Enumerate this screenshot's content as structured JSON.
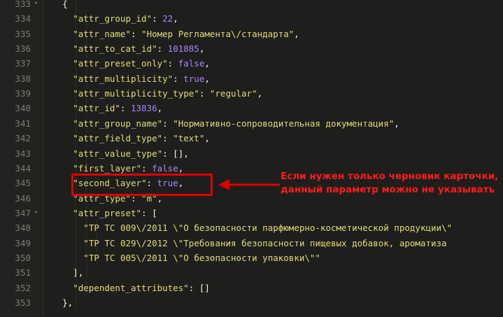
{
  "editor": {
    "lines": [
      {
        "num": "333",
        "fold": "▾",
        "indent": 7,
        "parts": [
          {
            "t": "{",
            "c": "p"
          }
        ]
      },
      {
        "num": "334",
        "fold": "",
        "indent": 9,
        "parts": [
          {
            "t": "\"attr_group_id\"",
            "c": "k"
          },
          {
            "t": ": ",
            "c": "p"
          },
          {
            "t": "22",
            "c": "n"
          },
          {
            "t": ",",
            "c": "p"
          }
        ]
      },
      {
        "num": "335",
        "fold": "",
        "indent": 9,
        "parts": [
          {
            "t": "\"attr_name\"",
            "c": "k"
          },
          {
            "t": ": ",
            "c": "p"
          },
          {
            "t": "\"Номер Регламента\\/стандарта\"",
            "c": "s"
          },
          {
            "t": ",",
            "c": "p"
          }
        ]
      },
      {
        "num": "336",
        "fold": "",
        "indent": 9,
        "parts": [
          {
            "t": "\"attr_to_cat_id\"",
            "c": "k"
          },
          {
            "t": ": ",
            "c": "p"
          },
          {
            "t": "101885",
            "c": "n"
          },
          {
            "t": ",",
            "c": "p"
          }
        ]
      },
      {
        "num": "337",
        "fold": "",
        "indent": 9,
        "parts": [
          {
            "t": "\"attr_preset_only\"",
            "c": "k"
          },
          {
            "t": ": ",
            "c": "p"
          },
          {
            "t": "false",
            "c": "b"
          },
          {
            "t": ",",
            "c": "p"
          }
        ]
      },
      {
        "num": "338",
        "fold": "",
        "indent": 9,
        "parts": [
          {
            "t": "\"attr_multiplicity\"",
            "c": "k"
          },
          {
            "t": ": ",
            "c": "p"
          },
          {
            "t": "true",
            "c": "b"
          },
          {
            "t": ",",
            "c": "p"
          }
        ]
      },
      {
        "num": "339",
        "fold": "",
        "indent": 9,
        "parts": [
          {
            "t": "\"attr_multiplicity_type\"",
            "c": "k"
          },
          {
            "t": ": ",
            "c": "p"
          },
          {
            "t": "\"regular\"",
            "c": "s"
          },
          {
            "t": ",",
            "c": "p"
          }
        ]
      },
      {
        "num": "340",
        "fold": "",
        "indent": 9,
        "parts": [
          {
            "t": "\"attr_id\"",
            "c": "k"
          },
          {
            "t": ": ",
            "c": "p"
          },
          {
            "t": "13836",
            "c": "n"
          },
          {
            "t": ",",
            "c": "p"
          }
        ]
      },
      {
        "num": "341",
        "fold": "",
        "indent": 9,
        "parts": [
          {
            "t": "\"attr_group_name\"",
            "c": "k"
          },
          {
            "t": ": ",
            "c": "p"
          },
          {
            "t": "\"Нормативно-сопроводительная документация\"",
            "c": "s"
          },
          {
            "t": ",",
            "c": "p"
          }
        ]
      },
      {
        "num": "342",
        "fold": "",
        "indent": 9,
        "parts": [
          {
            "t": "\"attr_field_type\"",
            "c": "k"
          },
          {
            "t": ": ",
            "c": "p"
          },
          {
            "t": "\"text\"",
            "c": "s"
          },
          {
            "t": ",",
            "c": "p"
          }
        ]
      },
      {
        "num": "343",
        "fold": "",
        "indent": 9,
        "parts": [
          {
            "t": "\"attr_value_type\"",
            "c": "k"
          },
          {
            "t": ": [],",
            "c": "p"
          }
        ]
      },
      {
        "num": "344",
        "fold": "",
        "indent": 9,
        "parts": [
          {
            "t": "\"first_layer\"",
            "c": "k"
          },
          {
            "t": ": ",
            "c": "p"
          },
          {
            "t": "false",
            "c": "b"
          },
          {
            "t": ",",
            "c": "p"
          }
        ]
      },
      {
        "num": "345",
        "fold": "",
        "indent": 9,
        "parts": [
          {
            "t": "\"second_layer\"",
            "c": "k"
          },
          {
            "t": ": ",
            "c": "p"
          },
          {
            "t": "true",
            "c": "b"
          },
          {
            "t": ",",
            "c": "p"
          }
        ]
      },
      {
        "num": "346",
        "fold": "",
        "indent": 9,
        "parts": [
          {
            "t": "\"attr_type\"",
            "c": "k"
          },
          {
            "t": ": ",
            "c": "p"
          },
          {
            "t": "\"m\"",
            "c": "s"
          },
          {
            "t": ",",
            "c": "p"
          }
        ]
      },
      {
        "num": "347",
        "fold": "▾",
        "indent": 9,
        "parts": [
          {
            "t": "\"attr_preset\"",
            "c": "k"
          },
          {
            "t": ": [",
            "c": "p"
          }
        ]
      },
      {
        "num": "348",
        "fold": "",
        "indent": 11,
        "parts": [
          {
            "t": "\"ТР ТС 009\\/2011 \\\"О безопасности парфюмерно-косметической продукции\\\"",
            "c": "s"
          }
        ]
      },
      {
        "num": "349",
        "fold": "",
        "indent": 11,
        "parts": [
          {
            "t": "\"ТР ТС 029\\/2012 \\\"Требования безопасности пищевых добавок, ароматиза",
            "c": "s"
          }
        ]
      },
      {
        "num": "350",
        "fold": "",
        "indent": 11,
        "parts": [
          {
            "t": "\"ТР ТС 005\\/2011 \\\"О безопасности упаковки\\\"\"",
            "c": "s"
          }
        ]
      },
      {
        "num": "351",
        "fold": "",
        "indent": 9,
        "parts": [
          {
            "t": "],",
            "c": "p"
          }
        ]
      },
      {
        "num": "352",
        "fold": "",
        "indent": 9,
        "parts": [
          {
            "t": "\"dependent_attributes\"",
            "c": "k"
          },
          {
            "t": ": []",
            "c": "p"
          }
        ]
      },
      {
        "num": "353",
        "fold": "",
        "indent": 7,
        "parts": [
          {
            "t": "},",
            "c": "p"
          }
        ]
      }
    ]
  },
  "annotation": {
    "line1": "Если нужен только черновик карточки,",
    "line2": "данный параметр можно не указывать",
    "color": "#ff1a1a"
  },
  "highlight": {
    "line": "345",
    "color": "#e00000"
  }
}
